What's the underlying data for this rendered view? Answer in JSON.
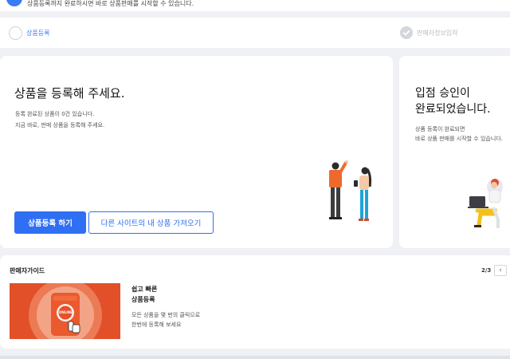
{
  "notice": {
    "message": "상품등록까지 완료하시면 바로 상품판매를 시작할 수 있습니다."
  },
  "steps": {
    "step1_label": "상품등록",
    "step2_label": "판매자정보입력"
  },
  "register_card": {
    "title": "상품을 등록해 주세요.",
    "desc_line1": "등록 완료된 상품이 0건 있습니다.",
    "desc_line2": "지금 바로, 판매 상품을 등록해 주세요.",
    "primary_button": "상품등록 하기",
    "secondary_button": "다른 사이트의 내 상품 가져오기"
  },
  "approval_card": {
    "title_line1": "입점 승인이",
    "title_line2": "완료되었습니다.",
    "desc_line1": "상품 등록이 완료되면",
    "desc_line2": "바로 상품 판매를 시작할 수 있습니다."
  },
  "guide": {
    "title": "판매자가이드",
    "pager": "2/3",
    "prev_icon": "‹",
    "item": {
      "heading_line1": "쉽고 빠른",
      "heading_line2": "상품등록",
      "body_line1": "모든 상품을 몇 번의 클릭으로",
      "body_line2": "한번에 등록해 보세요",
      "badge_text": "ONLINE"
    }
  },
  "colors": {
    "accent": "#2f6ff3",
    "thumbnail_bg": "#e2502a"
  }
}
